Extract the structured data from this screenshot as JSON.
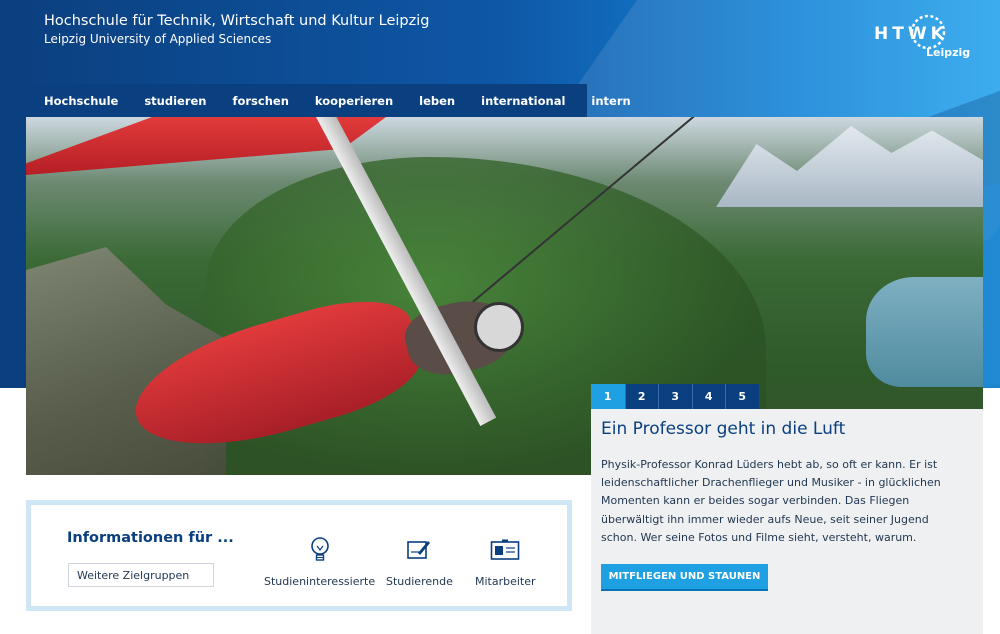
{
  "header": {
    "title": "Hochschule für Technik, Wirtschaft und Kultur Leipzig",
    "subtitle": "Leipzig University of Applied Sciences",
    "logo_text": "HTWK",
    "logo_city": "Leipzig"
  },
  "nav": {
    "items": [
      {
        "label": "Hochschule"
      },
      {
        "label": "studieren"
      },
      {
        "label": "forschen"
      },
      {
        "label": "kooperieren"
      },
      {
        "label": "leben"
      },
      {
        "label": "international"
      },
      {
        "label": "intern"
      }
    ]
  },
  "slider": {
    "tabs": [
      "1",
      "2",
      "3",
      "4",
      "5"
    ],
    "active": "1"
  },
  "teaser": {
    "title": "Ein Professor geht in die Luft",
    "text": "Physik-Professor Konrad Lüders hebt ab, so oft er kann. Er ist leidenschaftlicher Drachenflieger und Musiker - in glücklichen Momenten kann er beides sogar verbinden. Das Fliegen überwältigt ihn immer wieder aufs Neue, seit seiner Jugend schon. Wer seine Fotos und Filme sieht, versteht, warum.",
    "button": "MITFLIEGEN UND STAUNEN"
  },
  "info": {
    "title": "Informationen für ...",
    "select_value": "Weitere Zielgruppen",
    "groups": [
      {
        "label": "Studieninteressierte",
        "icon": "lightbulb-icon"
      },
      {
        "label": "Studierende",
        "icon": "notepad-icon"
      },
      {
        "label": "Mitarbeiter",
        "icon": "id-card-icon"
      }
    ]
  },
  "colors": {
    "primary": "#0a3f80",
    "accent": "#1fa0e2",
    "panel": "#eef0f2"
  }
}
